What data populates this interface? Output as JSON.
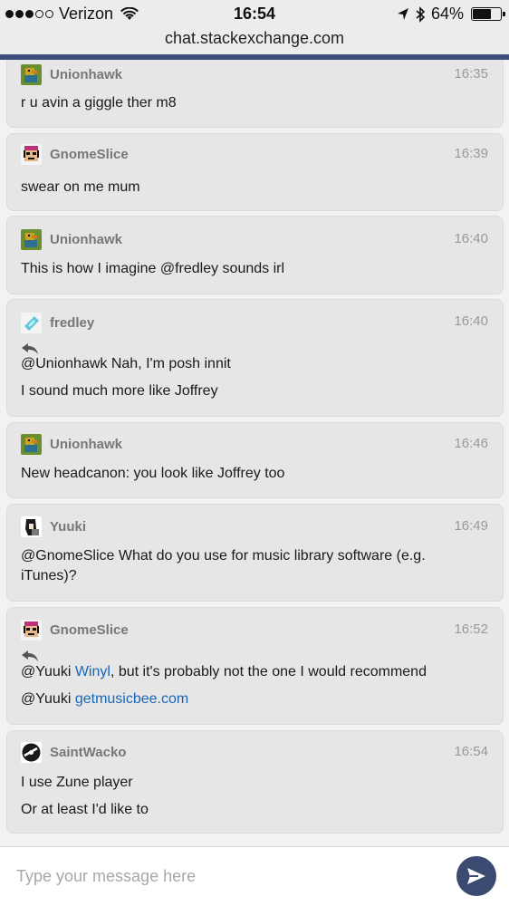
{
  "status_bar": {
    "carrier": "Verizon",
    "time": "16:54",
    "battery_text": "64%",
    "battery_level": 0.64,
    "signal_bars_filled": 3,
    "signal_bars_total": 5
  },
  "browser": {
    "url": "chat.stackexchange.com"
  },
  "messages": [
    {
      "user": "Unionhawk",
      "time": "16:35",
      "lines": [
        "r u avin a giggle ther m8"
      ],
      "avatar": "duck-avatar-icon"
    },
    {
      "user": "GnomeSlice",
      "time": "16:39",
      "lines": [
        "swear on me mum"
      ],
      "avatar": "pixel-face-avatar-icon"
    },
    {
      "user": "Unionhawk",
      "time": "16:40",
      "lines": [
        "This is how I imagine @fredley sounds irl"
      ],
      "avatar": "duck-avatar-icon"
    },
    {
      "user": "fredley",
      "time": "16:40",
      "reply": true,
      "lines": [
        "@Unionhawk Nah, I'm posh innit",
        "I sound much more like Joffrey"
      ],
      "avatar": "diamond-avatar-icon"
    },
    {
      "user": "Unionhawk",
      "time": "16:46",
      "lines": [
        "New headcanon: you look like Joffrey too"
      ],
      "avatar": "duck-avatar-icon"
    },
    {
      "user": "Yuuki",
      "time": "16:49",
      "lines": [
        "@GnomeSlice What do you use for music library software (e.g.",
        "iTunes)?"
      ],
      "avatar": "anime-avatar-icon"
    },
    {
      "user": "GnomeSlice",
      "time": "16:52",
      "reply": true,
      "line1_prefix": "@Yuuki ",
      "line1_link": "Winyl",
      "line1_suffix": ", but it's probably not the one I would recommend",
      "line2_prefix": "@Yuuki ",
      "line2_link": "getmusicbee.com",
      "avatar": "pixel-face-avatar-icon"
    },
    {
      "user": "SaintWacko",
      "time": "16:54",
      "lines": [
        "I use Zune player",
        "Or at least I'd like to"
      ],
      "avatar": "disc-avatar-icon"
    }
  ],
  "composer": {
    "placeholder": "Type your message here"
  },
  "colors": {
    "accent": "#3b4f7a",
    "link": "#1a66b8",
    "bubble": "#e6e6e6"
  }
}
